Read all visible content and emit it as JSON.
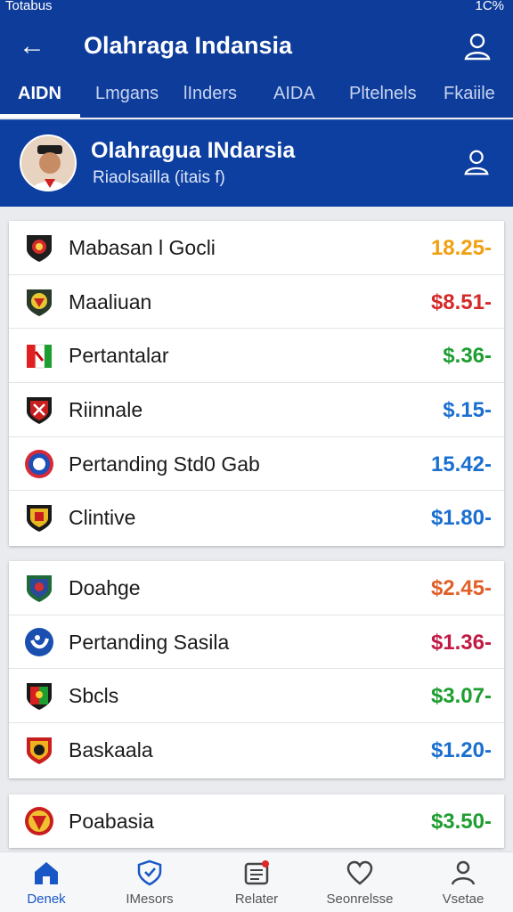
{
  "status": {
    "left": "Totabus",
    "right": "1C%"
  },
  "appbar": {
    "title": "Olahraga Indansia"
  },
  "tabs": [
    {
      "label": "AIDN",
      "active": true
    },
    {
      "label": "Lmgans"
    },
    {
      "label": "lInders"
    },
    {
      "label": "AIDA"
    },
    {
      "label": "Pltelnels"
    },
    {
      "label": "Fkaiile"
    }
  ],
  "header": {
    "name": "Olahragua INdarsia",
    "subtitle": "Riaolsailla (itais f)"
  },
  "list1": [
    {
      "label": "Mabasan l Gocli ",
      "value": "18.25-",
      "color": "#f0a010"
    },
    {
      "label": "Maaliuan",
      "value": "$8.51-",
      "color": "#d42a2a"
    },
    {
      "label": "Pertantalar ",
      "value": "$.36-",
      "color": "#1e9e30"
    },
    {
      "label": "Riinnale",
      "value": "$.15-",
      "color": "#1a6fd0"
    },
    {
      "label": "Pertanding Std0 Gab ",
      "value": "15.42-",
      "color": "#1a6fd0"
    },
    {
      "label": "Clintive",
      "value": "$1.80-",
      "color": "#1a6fd0"
    }
  ],
  "list2": [
    {
      "label": "Doahge",
      "value": "$2.45-",
      "color": "#e0602a"
    },
    {
      "label": "Pertanding Sasila",
      "value": "$1.36-",
      "color": "#c21a44"
    },
    {
      "label": "Sbcls",
      "value": "$3.07-",
      "color": "#1e9e30"
    },
    {
      "label": "Baskaala",
      "value": "$1.20-",
      "color": "#1a6fd0"
    }
  ],
  "list3": [
    {
      "label": "Poabasia",
      "value": "$3.50-",
      "color": "#1e9e30"
    }
  ],
  "nav": [
    {
      "label": "Denek",
      "icon": "home-icon",
      "active": true
    },
    {
      "label": "IMesors",
      "icon": "shield-icon"
    },
    {
      "label": "Relater",
      "icon": "news-icon"
    },
    {
      "label": "Seonrelsse",
      "icon": "heart-icon"
    },
    {
      "label": "Vsetae",
      "icon": "person-icon"
    }
  ]
}
